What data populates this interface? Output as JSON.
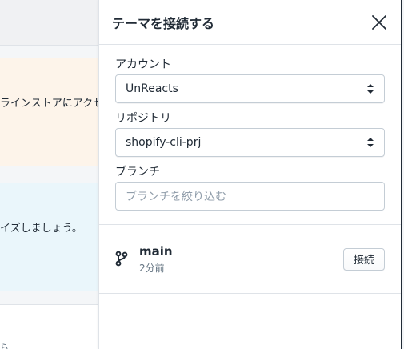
{
  "background": {
    "orange_card_text": "ラインストアにアクセ",
    "blue_card_text": "イズしましょう。",
    "bottom_fragment": "ら"
  },
  "sheet": {
    "title": "テーマを接続する",
    "account": {
      "label": "アカウント",
      "value": "UnReacts"
    },
    "repository": {
      "label": "リポジトリ",
      "value": "shopify-cli-prj"
    },
    "branch": {
      "label": "ブランチ",
      "placeholder": "ブランチを絞り込む"
    },
    "branches": [
      {
        "name": "main",
        "time": "2分前",
        "action_label": "接続"
      }
    ]
  },
  "colors": {
    "orange_card_bg": "#fdf4ea",
    "orange_card_border": "#e8b879",
    "blue_card_bg": "#eaf6fb",
    "blue_card_border": "#98c6cd"
  }
}
